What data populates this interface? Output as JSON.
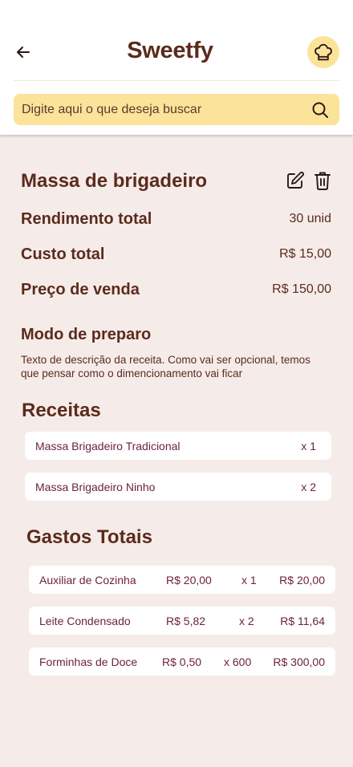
{
  "header": {
    "app_title": "Sweetfy",
    "search_placeholder": "Digite aqui o que deseja buscar"
  },
  "recipe": {
    "title": "Massa de brigadeiro",
    "stats": [
      {
        "label": "Rendimento total",
        "value": "30 unid"
      },
      {
        "label": "Custo total",
        "value": "R$ 15,00"
      },
      {
        "label": "Preço de venda",
        "value": "R$ 150,00"
      }
    ],
    "preparation_title": "Modo de preparo",
    "preparation_text": "Texto de descrição da receita. Como vai ser opcional, temos que pensar como o dimencionamento vai ficar"
  },
  "receitas": {
    "title": "Receitas",
    "items": [
      {
        "name": "Massa Brigadeiro Tradicional",
        "qty": "x 1"
      },
      {
        "name": "Massa Brigadeiro Ninho",
        "qty": "x 2"
      }
    ]
  },
  "gastos": {
    "title": "Gastos Totais",
    "items": [
      {
        "name": "Auxiliar de Cozinha",
        "unit_price": "R$ 20,00",
        "qty": "x 1",
        "total": "R$ 20,00"
      },
      {
        "name": "Leite Condensado",
        "unit_price": "R$ 5,82",
        "qty": "x 2",
        "total": "R$ 11,64"
      },
      {
        "name": "Forminhas de Doce",
        "unit_price": "R$ 0,50",
        "qty": "x 600",
        "total": "R$ 300,00"
      }
    ]
  },
  "colors": {
    "background": "#f5ecea",
    "accent_yellow": "#fbe39a",
    "brown_text": "#5b2b1c",
    "row_text": "#6b1f3c"
  },
  "icons": [
    "arrow-left-icon",
    "chef-hat-icon",
    "search-icon",
    "edit-icon",
    "trash-icon"
  ]
}
